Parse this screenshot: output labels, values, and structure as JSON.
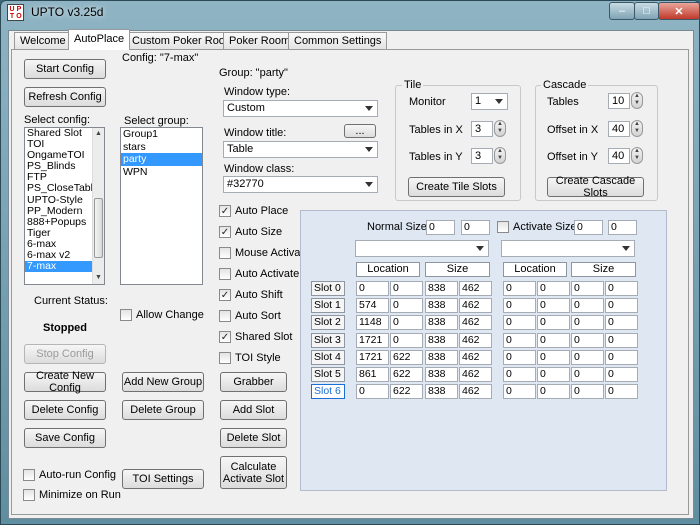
{
  "window": {
    "title": "UPTO  v3.25d",
    "icon_text": "UPTO",
    "minimize": "–",
    "maximize": "□",
    "close": "✕"
  },
  "tabs": [
    "Welcome",
    "AutoPlace",
    "Custom Poker Room",
    "Poker Room",
    "Common Settings"
  ],
  "left": {
    "start_config": "Start Config",
    "refresh_config": "Refresh Config",
    "select_config_label": "Select config:",
    "configs": [
      "Shared Slot",
      "TOI",
      "OngameTOI",
      "PS_Blinds",
      "FTP",
      "PS_CloseTable",
      "UPTO-Style",
      "PP_Modern",
      "888+Popups",
      "Tiger",
      "6-max",
      "6-max v2",
      "7-max"
    ],
    "selected_config": "7-max",
    "current_status_label": "Current Status:",
    "status": "Stopped",
    "stop_config": "Stop Config",
    "create_new_config": "Create New Config",
    "delete_config": "Delete Config",
    "save_config": "Save Config",
    "auto_run": "Auto-run Config",
    "minimize_on_run": "Minimize on Run"
  },
  "middle": {
    "config_title": "Config: \"7-max\"",
    "select_group_label": "Select group:",
    "groups": [
      "Group1",
      "stars",
      "party",
      "WPN"
    ],
    "selected_group": "party",
    "allow_change": "Allow Change",
    "add_new_group": "Add New Group",
    "delete_group": "Delete Group",
    "toi_settings": "TOI Settings"
  },
  "group": {
    "title": "Group: \"party\"",
    "window_type_label": "Window type:",
    "window_type": "Custom",
    "window_title_label": "Window title:",
    "window_title_btn": "...",
    "window_title": "Table",
    "window_class_label": "Window class:",
    "window_class": "#32770",
    "options": [
      {
        "label": "Auto Place",
        "checked": true
      },
      {
        "label": "Auto Size",
        "checked": true
      },
      {
        "label": "Mouse Activate",
        "checked": false
      },
      {
        "label": "Auto Activate",
        "checked": false
      },
      {
        "label": "Auto Shift",
        "checked": true
      },
      {
        "label": "Auto Sort",
        "checked": false
      },
      {
        "label": "Shared Slot",
        "checked": true
      },
      {
        "label": "TOI Style",
        "checked": false
      }
    ],
    "grabber": "Grabber",
    "add_slot": "Add Slot",
    "delete_slot": "Delete Slot",
    "calculate": "Calculate Activate Slot"
  },
  "tile": {
    "title": "Tile",
    "monitor_label": "Monitor",
    "monitor": "1",
    "tables_x_label": "Tables in X",
    "tables_x": "3",
    "tables_y_label": "Tables in Y",
    "tables_y": "3",
    "create_btn": "Create Tile Slots"
  },
  "cascade": {
    "title": "Cascade",
    "tables_label": "Tables",
    "tables": "10",
    "offset_x_label": "Offset in X",
    "offset_x": "40",
    "offset_y_label": "Offset in Y",
    "offset_y": "40",
    "create_btn": "Create Cascade Slots"
  },
  "slots": {
    "normal_size_label": "Normal Size",
    "normal_w": "0",
    "normal_h": "0",
    "activate_size_label": "Activate Size",
    "activate_w": "0",
    "activate_h": "0",
    "location_header": "Location",
    "size_header": "Size",
    "selected_slot": "Slot 6",
    "rows": [
      {
        "name": "Slot 0",
        "normal": [
          "0",
          "0",
          "838",
          "462"
        ],
        "activate": [
          "0",
          "0",
          "0",
          "0"
        ]
      },
      {
        "name": "Slot 1",
        "normal": [
          "574",
          "0",
          "838",
          "462"
        ],
        "activate": [
          "0",
          "0",
          "0",
          "0"
        ]
      },
      {
        "name": "Slot 2",
        "normal": [
          "1148",
          "0",
          "838",
          "462"
        ],
        "activate": [
          "0",
          "0",
          "0",
          "0"
        ]
      },
      {
        "name": "Slot 3",
        "normal": [
          "1721",
          "0",
          "838",
          "462"
        ],
        "activate": [
          "0",
          "0",
          "0",
          "0"
        ]
      },
      {
        "name": "Slot 4",
        "normal": [
          "1721",
          "622",
          "838",
          "462"
        ],
        "activate": [
          "0",
          "0",
          "0",
          "0"
        ]
      },
      {
        "name": "Slot 5",
        "normal": [
          "861",
          "622",
          "838",
          "462"
        ],
        "activate": [
          "0",
          "0",
          "0",
          "0"
        ]
      },
      {
        "name": "Slot 6",
        "normal": [
          "0",
          "622",
          "838",
          "462"
        ],
        "activate": [
          "0",
          "0",
          "0",
          "0"
        ]
      }
    ]
  }
}
